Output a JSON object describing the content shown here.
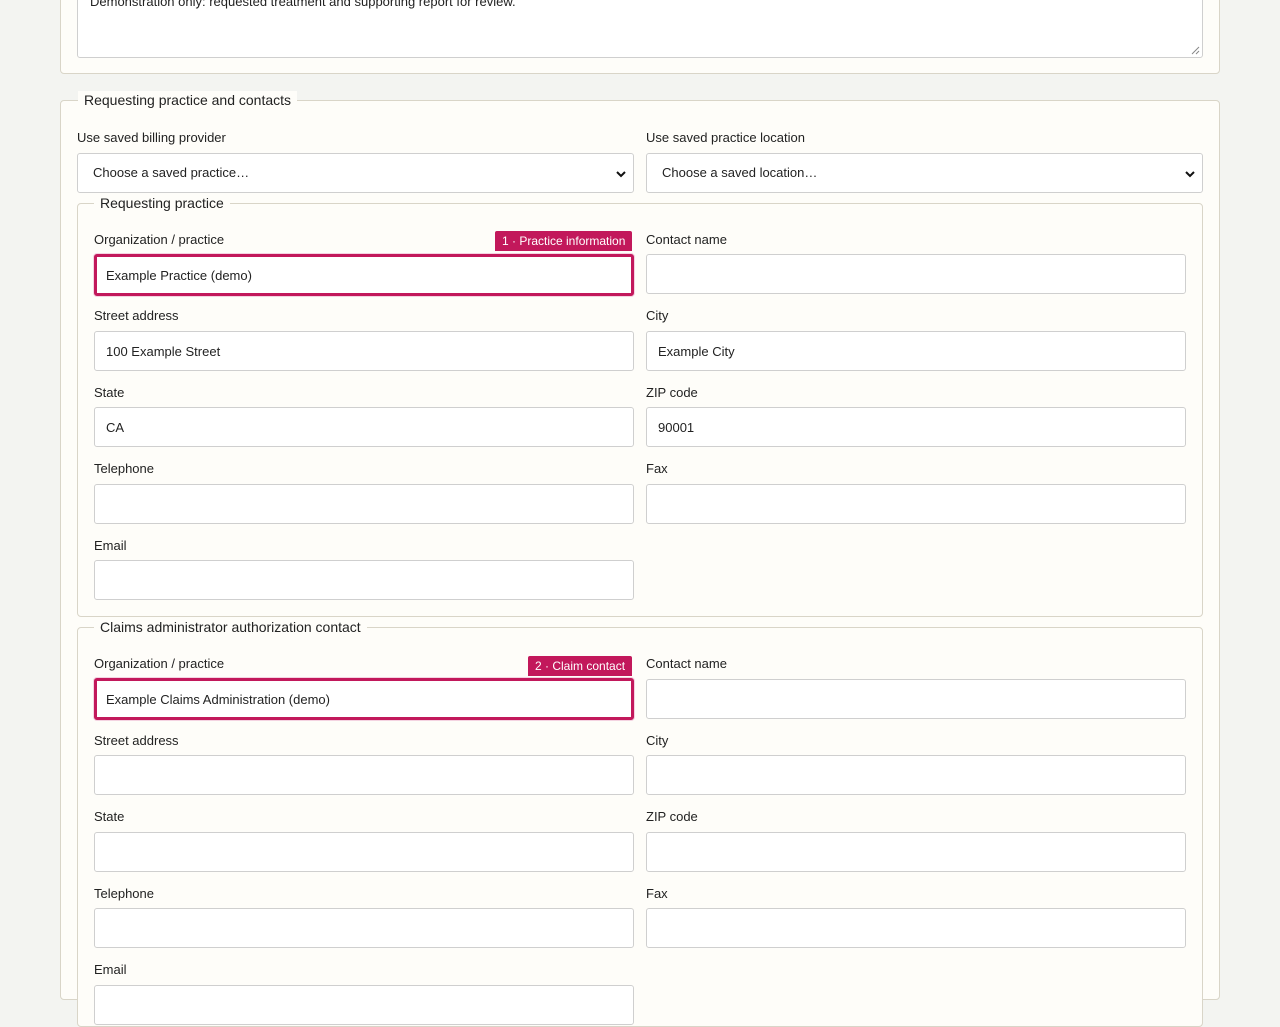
{
  "notes": {
    "text": "Demonstration only: requested treatment and supporting report for review."
  },
  "contacts_section": {
    "legend": "Requesting practice and contacts",
    "billing_provider": {
      "label": "Use saved billing provider",
      "selected": "Choose a saved practice…"
    },
    "practice_location": {
      "label": "Use saved practice location",
      "selected": "Choose a saved location…"
    }
  },
  "requesting_practice": {
    "legend": "Requesting practice",
    "badge": "1 · Practice information",
    "org": {
      "label": "Organization / practice",
      "value": "Example Practice (demo)"
    },
    "contact": {
      "label": "Contact name",
      "value": ""
    },
    "street": {
      "label": "Street address",
      "value": "100 Example Street"
    },
    "city": {
      "label": "City",
      "value": "Example City"
    },
    "state": {
      "label": "State",
      "value": "CA"
    },
    "zip": {
      "label": "ZIP code",
      "value": "90001"
    },
    "telephone": {
      "label": "Telephone",
      "value": ""
    },
    "fax": {
      "label": "Fax",
      "value": ""
    },
    "email": {
      "label": "Email",
      "value": ""
    }
  },
  "claims_contact": {
    "legend": "Claims administrator authorization contact",
    "badge": "2 · Claim contact",
    "org": {
      "label": "Organization / practice",
      "value": "Example Claims Administration (demo)"
    },
    "contact": {
      "label": "Contact name",
      "value": ""
    },
    "street": {
      "label": "Street address",
      "value": ""
    },
    "city": {
      "label": "City",
      "value": ""
    },
    "state": {
      "label": "State",
      "value": ""
    },
    "zip": {
      "label": "ZIP code",
      "value": ""
    },
    "telephone": {
      "label": "Telephone",
      "value": ""
    },
    "fax": {
      "label": "Fax",
      "value": ""
    },
    "email": {
      "label": "Email",
      "value": ""
    }
  },
  "colors": {
    "highlight": "#c2185b",
    "panel": "#fefdf9",
    "page": "#f3f4f1"
  }
}
